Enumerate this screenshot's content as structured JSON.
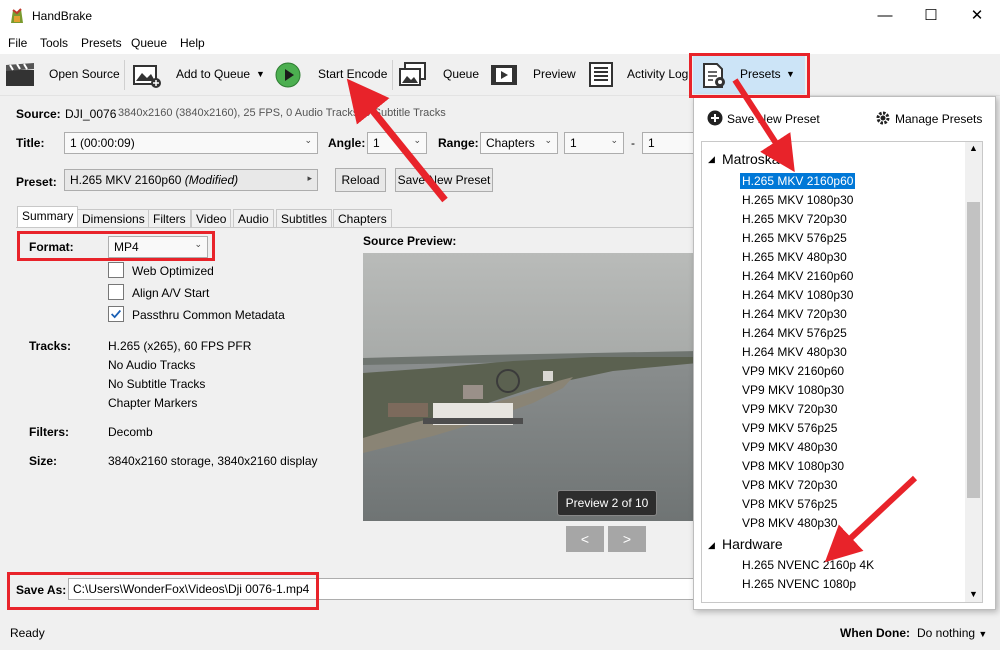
{
  "window": {
    "title": "HandBrake",
    "minimize": "—",
    "maximize": "☐",
    "close": "✕"
  },
  "menu": [
    "File",
    "Tools",
    "Presets",
    "Queue",
    "Help"
  ],
  "toolbar": {
    "open_source": "Open Source",
    "add_to_queue": "Add to Queue",
    "start_encode": "Start Encode",
    "queue": "Queue",
    "preview": "Preview",
    "activity_log": "Activity Log",
    "presets": "Presets"
  },
  "source": {
    "label": "Source:",
    "name": "DJI_0076",
    "info": "3840x2160 (3840x2160), 25 FPS, 0 Audio Tracks, 0 Subtitle Tracks"
  },
  "title_row": {
    "title_label": "Title:",
    "title_value": "1 (00:00:09)",
    "angle_label": "Angle:",
    "angle_value": "1",
    "range_label": "Range:",
    "range_value": "Chapters",
    "range_start": "1",
    "dash": "-",
    "range_end": "1"
  },
  "preset_row": {
    "label": "Preset:",
    "value": "H.265 MKV 2160p60",
    "modified": "(Modified)",
    "reload": "Reload",
    "save_new": "Save New Preset"
  },
  "tabs": [
    "Summary",
    "Dimensions",
    "Filters",
    "Video",
    "Audio",
    "Subtitles",
    "Chapters"
  ],
  "summary": {
    "format_label": "Format:",
    "format_value": "MP4",
    "web_optimized": "Web Optimized",
    "align_av": "Align A/V Start",
    "passthru": "Passthru Common Metadata",
    "tracks_label": "Tracks:",
    "tracks": [
      "H.265 (x265), 60 FPS PFR",
      "No Audio Tracks",
      "No Subtitle Tracks",
      "Chapter Markers"
    ],
    "filters_label": "Filters:",
    "filters_value": "Decomb",
    "size_label": "Size:",
    "size_value": "3840x2160 storage, 3840x2160 display"
  },
  "preview": {
    "label": "Source Preview:",
    "badge": "Preview 2 of 10",
    "prev": "<",
    "next": ">"
  },
  "save_as": {
    "label": "Save As:",
    "value": "C:\\Users\\WonderFox\\Videos\\Dji 0076-1.mp4"
  },
  "status": {
    "ready": "Ready",
    "when_done_label": "When Done:",
    "when_done_value": "Do nothing"
  },
  "presets_panel": {
    "save_new": "Save New Preset",
    "manage": "Manage Presets",
    "groups": [
      {
        "name": "Matroska",
        "items": [
          "H.265 MKV 2160p60",
          "H.265 MKV 1080p30",
          "H.265 MKV 720p30",
          "H.265 MKV 576p25",
          "H.265 MKV 480p30",
          "H.264 MKV 2160p60",
          "H.264 MKV 1080p30",
          "H.264 MKV 720p30",
          "H.264 MKV 576p25",
          "H.264 MKV 480p30",
          "VP9 MKV 2160p60",
          "VP9 MKV 1080p30",
          "VP9 MKV 720p30",
          "VP9 MKV 576p25",
          "VP9 MKV 480p30",
          "VP8 MKV 1080p30",
          "VP8 MKV 720p30",
          "VP8 MKV 576p25",
          "VP8 MKV 480p30"
        ]
      },
      {
        "name": "Hardware",
        "items": [
          "H.265 NVENC 2160p 4K",
          "H.265 NVENC 1080p"
        ]
      }
    ],
    "selected_color": "#0078d7"
  }
}
